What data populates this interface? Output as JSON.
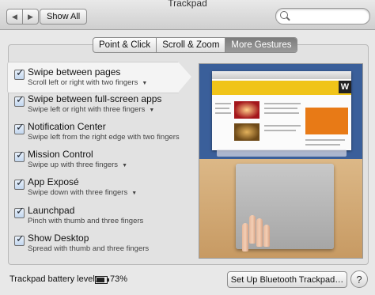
{
  "window": {
    "title": "Trackpad"
  },
  "toolbar": {
    "back_icon": "chevron-left",
    "forward_icon": "chevron-right",
    "show_all_label": "Show All",
    "search": {
      "placeholder": "",
      "value": ""
    }
  },
  "tabs": [
    {
      "label": "Point & Click",
      "selected": false
    },
    {
      "label": "Scroll & Zoom",
      "selected": false
    },
    {
      "label": "More Gestures",
      "selected": true
    }
  ],
  "gestures": [
    {
      "title": "Swipe between pages",
      "description": "Scroll left or right with two fingers",
      "has_dropdown": true,
      "checked": true,
      "selected": true
    },
    {
      "title": "Swipe between full-screen apps",
      "description": "Swipe left or right with three fingers",
      "has_dropdown": true,
      "checked": true,
      "selected": false
    },
    {
      "title": "Notification Center",
      "description": "Swipe left from the right edge with two fingers",
      "has_dropdown": false,
      "checked": true,
      "selected": false
    },
    {
      "title": "Mission Control",
      "description": "Swipe up with three fingers",
      "has_dropdown": true,
      "checked": true,
      "selected": false
    },
    {
      "title": "App Exposé",
      "description": "Swipe down with three fingers",
      "has_dropdown": true,
      "checked": true,
      "selected": false
    },
    {
      "title": "Launchpad",
      "description": "Pinch with thumb and three fingers",
      "has_dropdown": false,
      "checked": true,
      "selected": false
    },
    {
      "title": "Show Desktop",
      "description": "Spread with thumb and three fingers",
      "has_dropdown": false,
      "checked": true,
      "selected": false
    }
  ],
  "footer": {
    "battery_label": "Trackpad battery level:",
    "battery_percent": "73%",
    "bluetooth_button": "Set Up Bluetooth Trackpad…",
    "help_label": "?"
  },
  "colors": {
    "selected_tab": "#8a8a8a",
    "preview_sky": "#3a5f9a",
    "preview_wood": "#c89a64"
  }
}
